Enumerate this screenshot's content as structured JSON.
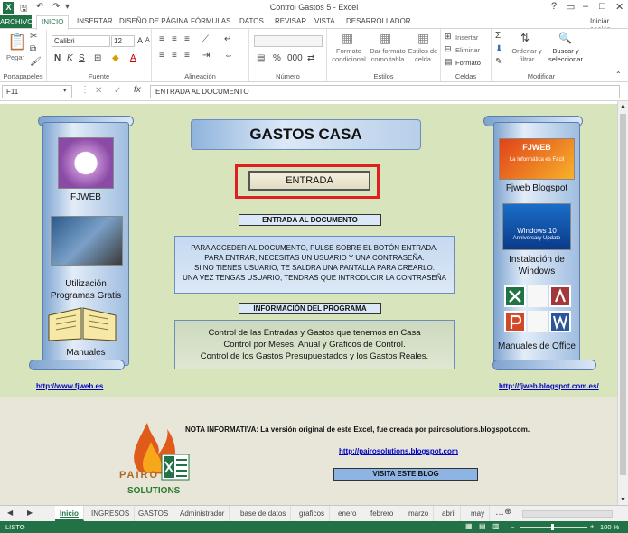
{
  "window": {
    "title": "Control Gastos 5 - Excel",
    "help": "?",
    "signin": "Iniciar sesión"
  },
  "ribbon_tabs": [
    "ARCHIVO",
    "INICIO",
    "INSERTAR",
    "DISEÑO DE PÁGINA",
    "FÓRMULAS",
    "DATOS",
    "REVISAR",
    "VISTA",
    "DESARROLLADOR"
  ],
  "ribbon": {
    "clipboard": {
      "paste": "Pegar",
      "label": "Portapapeles"
    },
    "font": {
      "name": "Calibri",
      "size": "12",
      "bold": "N",
      "italic": "K",
      "underline": "S",
      "grow": "A",
      "shrink": "A",
      "fontcolor": "A",
      "label": "Fuente"
    },
    "alignment": {
      "label": "Alineación"
    },
    "number": {
      "label": "Número"
    },
    "styles": {
      "cond": "Formato condicional",
      "table": "Dar formato como tabla",
      "cell": "Estilos de celda",
      "label": "Estilos"
    },
    "cells": {
      "insert": "Insertar",
      "delete": "Eliminar",
      "format": "Formato",
      "label": "Celdas"
    },
    "editing": {
      "sort": "Ordenar y filtrar",
      "find": "Buscar y seleccionar",
      "label": "Modificar"
    }
  },
  "formula_bar": {
    "namebox": "F11",
    "fx": "fx",
    "value": "ENTRADA AL DOCUMENTO"
  },
  "sheet": {
    "header_title": "GASTOS CASA",
    "entry_button": "ENTRADA",
    "entry_label": "ENTRADA AL DOCUMENTO",
    "entry_lines": [
      "PARA  ACCEDER AL DOCUMENTO, PULSE SOBRE EL BOTÓN ENTRADA.",
      "PARA ENTRAR, NECESITAS UN USUARIO Y UNA CONTRASEÑA.",
      "SI NO TIENES USUARIO, TE SALDRA UNA PANTALLA PARA CREARLO.",
      "UNA VEZ TENGAS USUARIO, TENDRAS QUE INTRODUCIR LA CONTRASEÑA"
    ],
    "info_label": "INFORMACIÓN DEL PROGRAMA",
    "info_lines": [
      "Control de las Entradas y Gastos que tenemos en Casa",
      "Control por Meses, Anual y Graficos de Control.",
      "Control de los Gastos Presupuestados y los Gastos Reales."
    ],
    "left_panel": {
      "item1": "FJWEB",
      "item2": "Utilización Programas Gratis",
      "item3": "Manuales",
      "link": "http://www.fjweb.es"
    },
    "right_panel": {
      "item1": "Fjweb Blogspot",
      "item1_logo": "FJWEB",
      "item1_logo_sub": "La Informática es Fácil",
      "item2": "Instalación de Windows",
      "item2_logo": "Windows 10",
      "item2_logo_sub": "Anniversary Update",
      "item3": "Manuales de Office",
      "link": "http://fjweb.blogspot.com.es/"
    },
    "note": "NOTA INFORMATIVA: La versión original de este Excel, fue creada por pairosolutions.blogspot.com.",
    "note_link": "http://pairosolutions.blogspot.com",
    "visit_button": "VISITA ESTE BLOG",
    "logo_text": "SOLUTIONS",
    "logo_brand": "PAIRO"
  },
  "sheet_tabs": [
    "Inicio",
    "INGRESOS",
    "GASTOS",
    "Administrador",
    "base de datos",
    "graficos",
    "enero",
    "febrero",
    "marzo",
    "abril",
    "may"
  ],
  "status": {
    "mode": "LISTO",
    "zoom": "100 %"
  }
}
